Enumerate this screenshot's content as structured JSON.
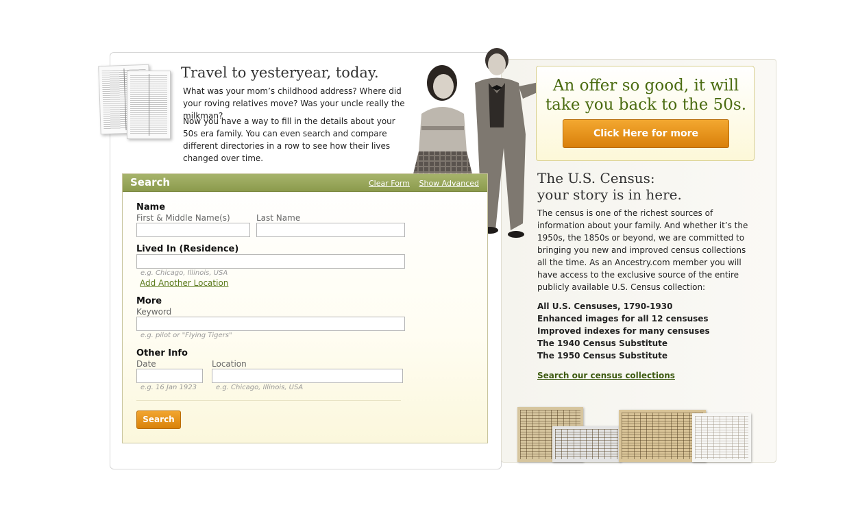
{
  "intro": {
    "title": "Travel to yesteryear, today.",
    "paragraph1": "What was your mom’s childhood address? Where did your roving relatives move? Was your uncle really the milkman?",
    "paragraph2": "Now you have a way to fill in the details about your 50s era family. You can even search and compare different directories in a row to see how their lives changed over time."
  },
  "search": {
    "title": "Search",
    "clear_form": "Clear Form",
    "show_advanced": "Show Advanced",
    "name_section": "Name",
    "first_name_label": "First & Middle Name(s)",
    "last_name_label": "Last Name",
    "first_name_value": "",
    "last_name_value": "",
    "lived_in_section": "Lived In (Residence)",
    "residence_value": "",
    "residence_hint": "e.g. Chicago, Illinois, USA",
    "add_location": "Add Another Location",
    "more_section": "More",
    "keyword_label": "Keyword",
    "keyword_value": "",
    "keyword_hint": "e.g. pilot or \"Flying Tigers\"",
    "other_section": "Other Info",
    "date_label": "Date",
    "date_value": "",
    "date_hint": "e.g. 16 Jan 1923",
    "location_label": "Location",
    "location_value": "",
    "location_hint": "e.g. Chicago, Illinois, USA",
    "button": "Search"
  },
  "offer": {
    "text": "An offer so good, it will take you back to the 50s.",
    "button": "Click Here for more"
  },
  "census": {
    "title_line1": "The U.S. Census:",
    "title_line2": "your story is in here.",
    "body": "The census is one of the richest sources of information about your family. And whether it’s the 1950s, the 1850s or beyond, we are committed to bringing you new and improved census collections all the time. As an Ancestry.com member you will have access to the exclusive source of the entire publicly available U.S. Census collection:",
    "items": [
      "All U.S. Censuses, 1790-1930",
      "Enhanced images for all 12 censuses",
      "Improved indexes for many censuses",
      "The 1940 Census Substitute",
      "The 1950 Census Substitute"
    ],
    "link": "Search our census collections"
  },
  "colors": {
    "accent_green": "#8b9a4c",
    "offer_green": "#4a6b10",
    "button_orange": "#e8940f"
  }
}
